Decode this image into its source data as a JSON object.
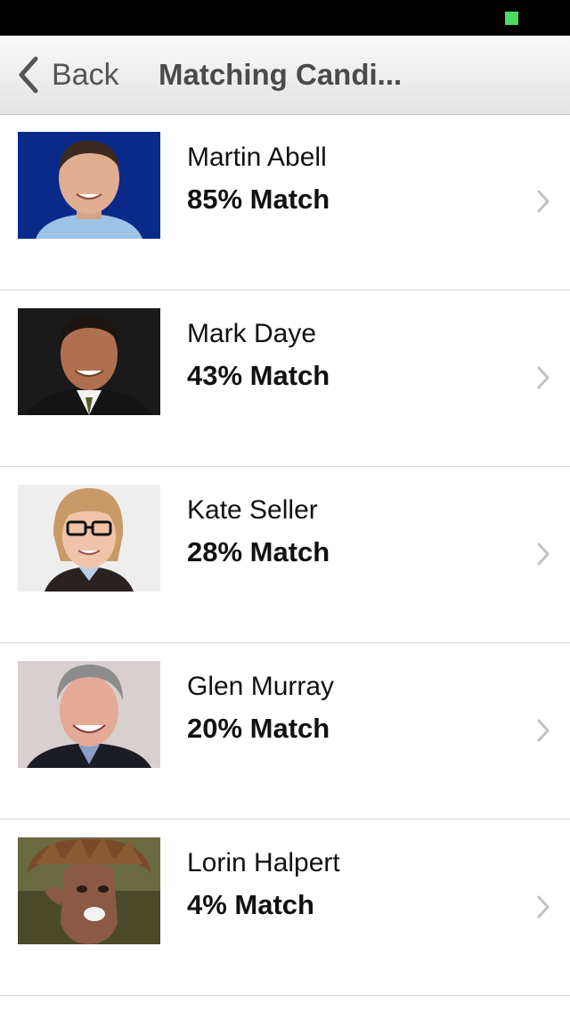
{
  "nav": {
    "back_label": "Back",
    "title": "Matching Candi..."
  },
  "candidates": [
    {
      "name": "Martin Abell",
      "match": "85% Match"
    },
    {
      "name": "Mark Daye",
      "match": "43% Match"
    },
    {
      "name": "Kate Seller",
      "match": "28% Match"
    },
    {
      "name": "Glen Murray",
      "match": "20% Match"
    },
    {
      "name": "Lorin Halpert",
      "match": "4% Match"
    }
  ],
  "colors": {
    "status_indicator": "#4cd964",
    "nav_text": "#4a4a4a",
    "separator": "#d4d4d4"
  }
}
